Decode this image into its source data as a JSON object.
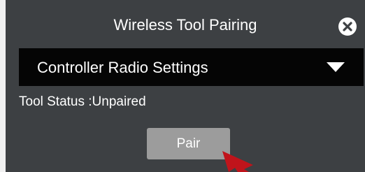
{
  "dialog": {
    "title": "Wireless Tool Pairing",
    "dropdown": {
      "selected": "Controller Radio Settings"
    },
    "status_text": "Tool Status :Unpaired",
    "pair_button_label": "Pair"
  },
  "icons": {
    "close": "close-circle-icon",
    "dropdown": "caret-down-icon",
    "pointer": "red-arrow-cursor-icon"
  },
  "colors": {
    "dialog_bg": "#3d4043",
    "dropdown_bg": "#050505",
    "button_bg": "#9c9c9c",
    "pointer": "#c0141b"
  }
}
